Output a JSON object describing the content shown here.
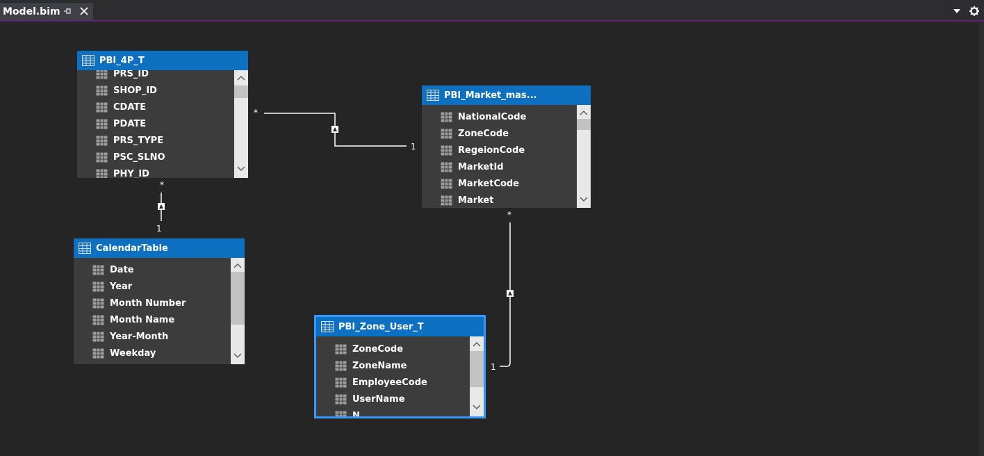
{
  "tab": {
    "title": "Model.bim"
  },
  "tables": {
    "pbi_4p_t": {
      "name": "PBI_4P_T",
      "columns": [
        "PRS_ID",
        "SHOP_ID",
        "CDATE",
        "PDATE",
        "PRS_TYPE",
        "PSC_SLNO",
        "PHY_ID"
      ]
    },
    "calendar": {
      "name": "CalendarTable",
      "columns": [
        "Date",
        "Year",
        "Month Number",
        "Month Name",
        "Year-Month",
        "Weekday"
      ]
    },
    "market": {
      "name": "PBI_Market_mas...",
      "columns": [
        "NationalCode",
        "ZoneCode",
        "RegeionCode",
        "MarketId",
        "MarketCode",
        "Market"
      ]
    },
    "zone_user": {
      "name": "PBI_Zone_User_T",
      "columns": [
        "ZoneCode",
        "ZoneName",
        "EmployeeCode",
        "UserName",
        "N"
      ]
    }
  },
  "relationships": {
    "r1": {
      "from_card": "*",
      "to_card": "1"
    },
    "r2": {
      "from_card": "*",
      "to_card": "1"
    },
    "r3": {
      "from_card": "*",
      "to_card": "1"
    }
  },
  "colors": {
    "canvas": "#252526",
    "table_header": "#0e70c0",
    "table_body": "#3c3c3c",
    "selection": "#3399ff",
    "tab_accent": "#68217a"
  },
  "icons": {
    "table": "table-grid-icon",
    "column": "column-icon",
    "pin": "pin-icon",
    "close": "close-icon",
    "dropdown": "chevron-down-icon",
    "settings": "gear-icon"
  }
}
